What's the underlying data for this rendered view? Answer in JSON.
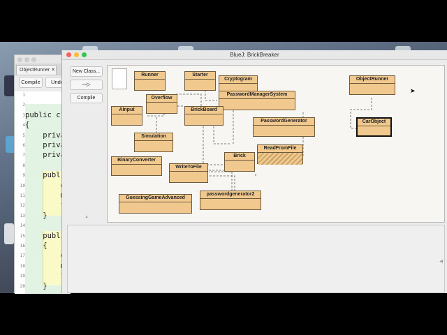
{
  "editor": {
    "tab_label": "ObjectRunner ✕",
    "compile_label": "Compile",
    "undo_label": "Undo",
    "line_numbers": [
      "1",
      "2",
      "3",
      "4",
      "5",
      "6",
      "7",
      "8",
      "9",
      "10",
      "11",
      "12",
      "13",
      "14",
      "15",
      "16",
      "17",
      "18",
      "19",
      "20"
    ],
    "code_lines": [
      "",
      "",
      "public cl",
      "{",
      "    priva",
      "    priva",
      "    priva",
      "",
      "    publi",
      "        d",
      "        m",
      "        f",
      "    }",
      "",
      "    publi",
      "    {",
      "        d",
      "        m",
      "        t",
      "    }"
    ]
  },
  "bluej": {
    "title": "BlueJ:  BrickBreaker",
    "new_class_label": "New Class...",
    "arrow_label": "—▷",
    "compile_label": "Compile",
    "classes": [
      "Runner",
      "Starter",
      "Cryptogram",
      "PasswordManagerSystem",
      "Overflow",
      "AInput",
      "BrickBoard",
      "PasswordGenerator",
      "Simulation",
      "ReadFromFile",
      "Brick",
      "BinaryConverter",
      "WriteToFile",
      "passwordgenerator2",
      "GuessingGameAdvanced",
      "ObjectRunner",
      "CarObject"
    ]
  },
  "colors": {
    "class_fill": "#f1c98f",
    "close": "#fc605c",
    "minimize": "#fdbc40",
    "maximize": "#34c84a"
  }
}
